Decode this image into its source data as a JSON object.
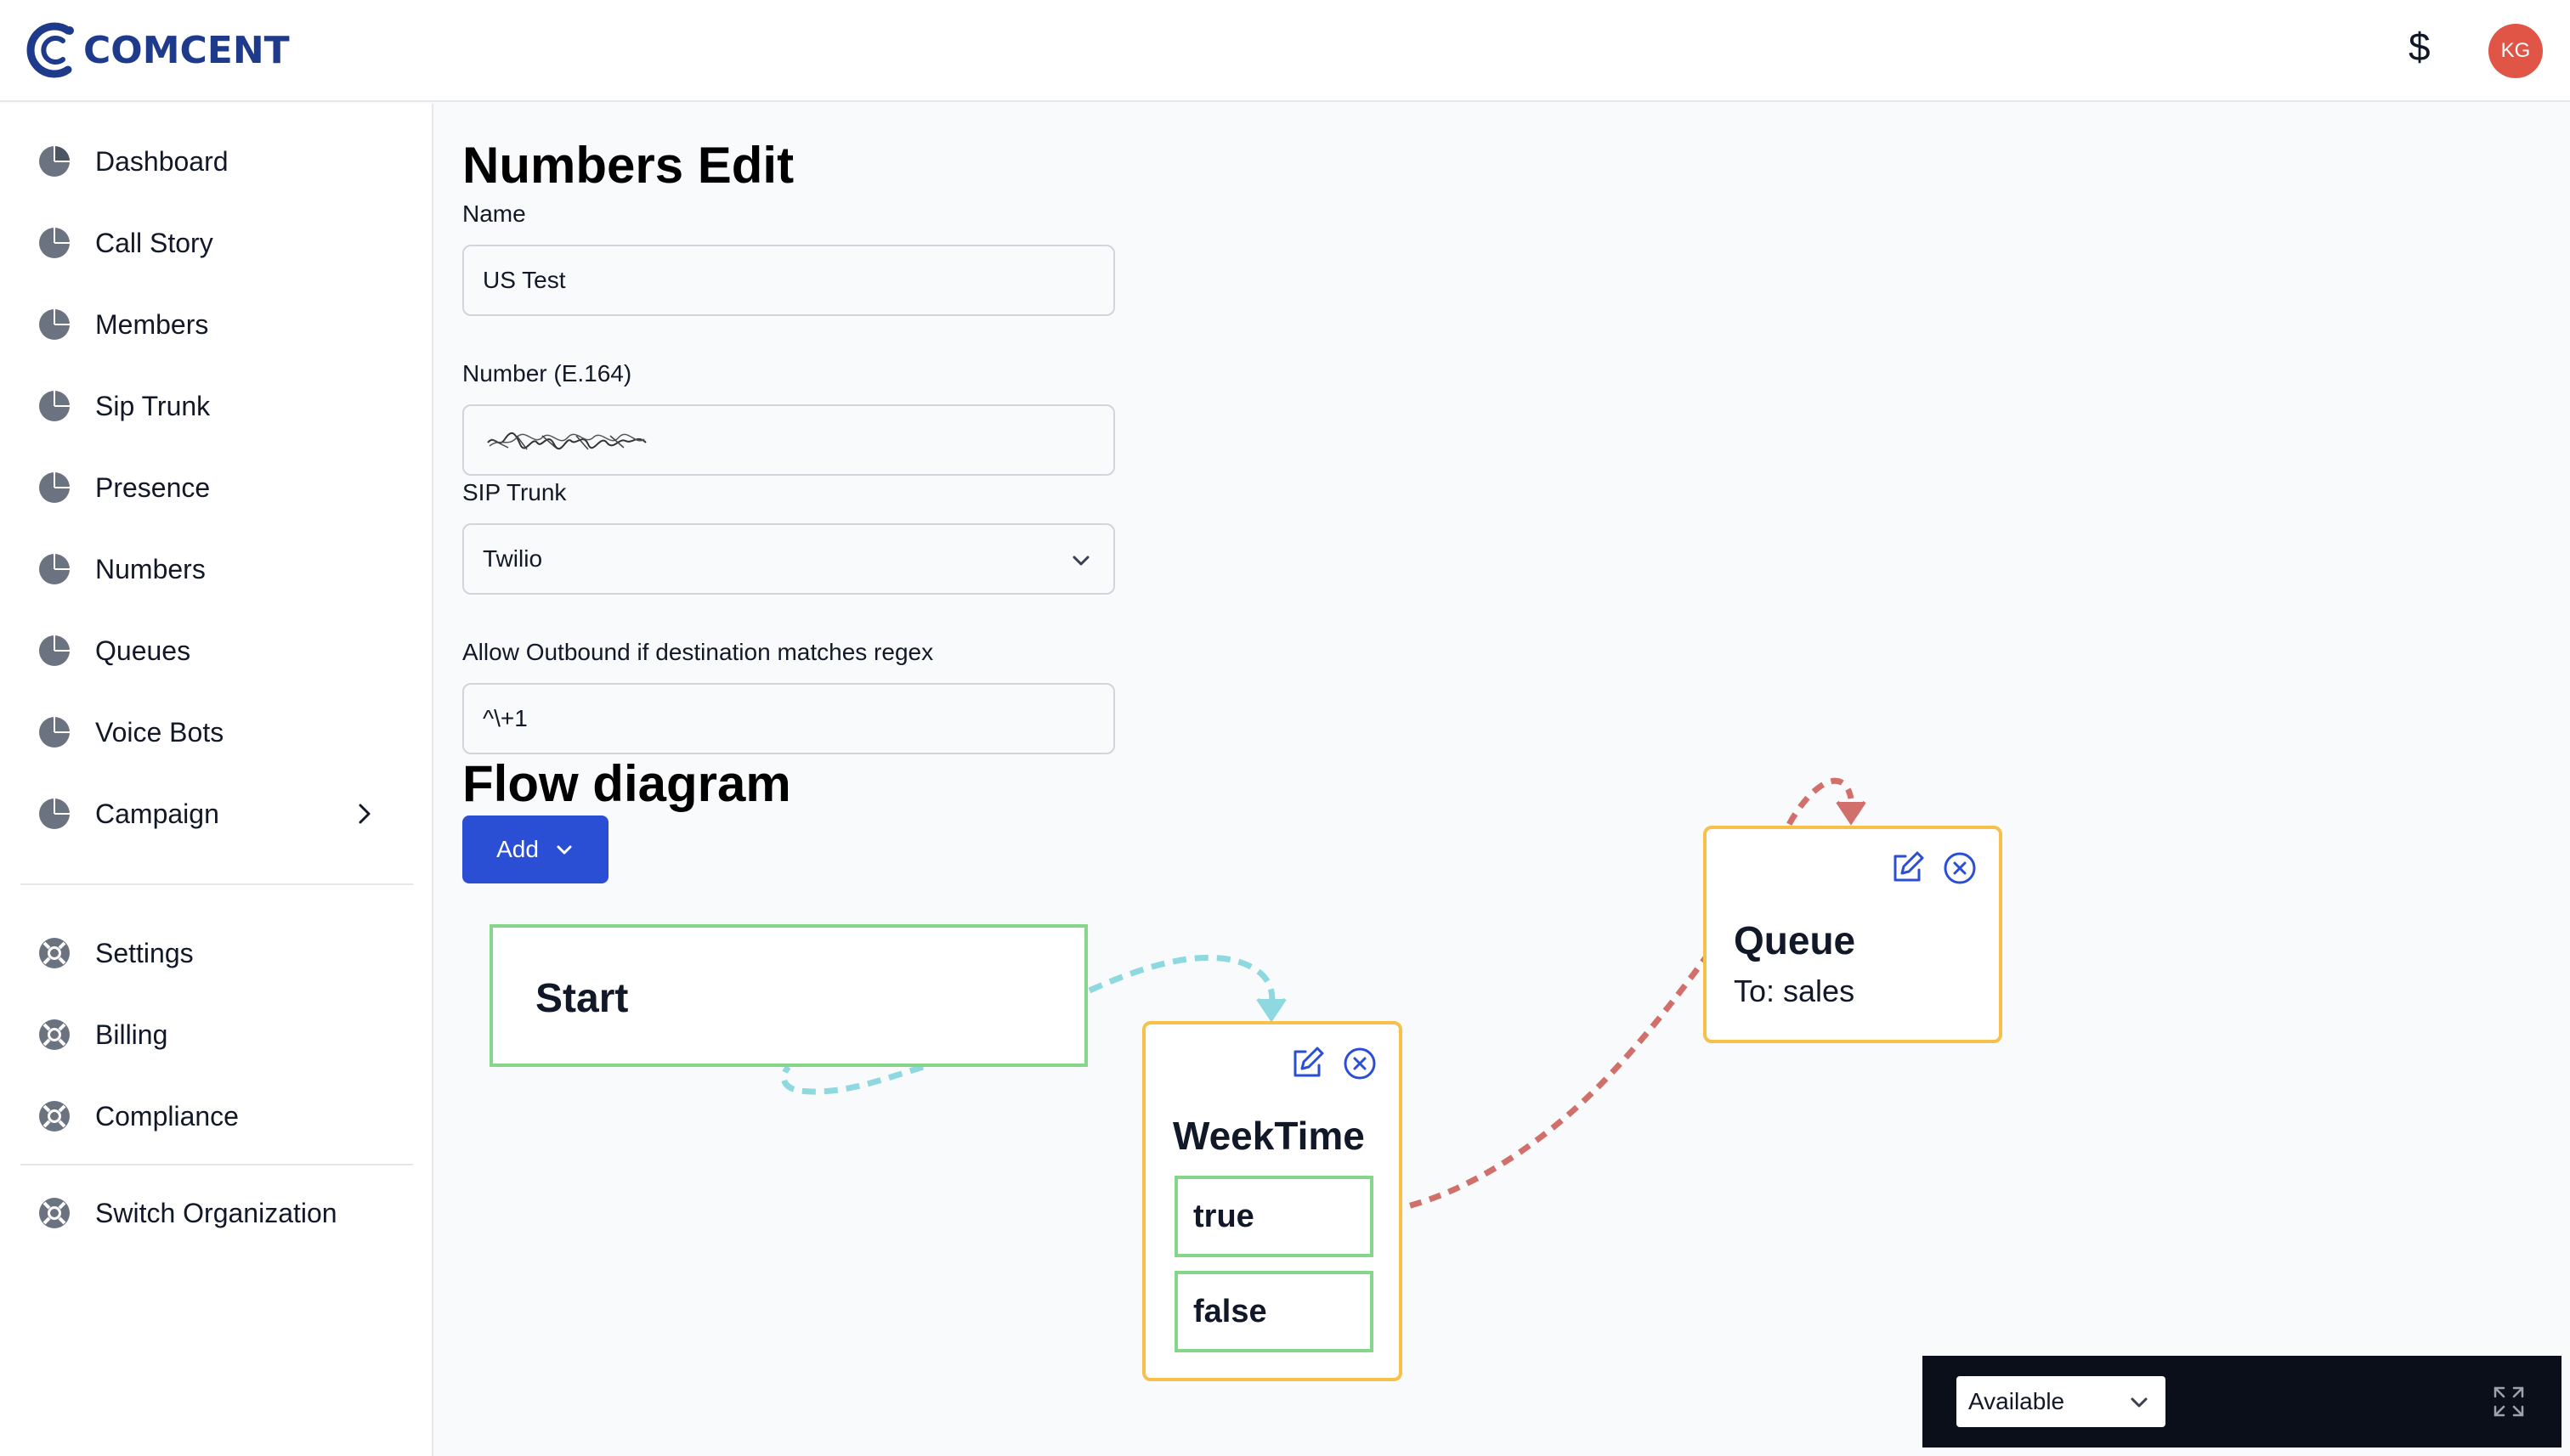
{
  "brand": {
    "name": "COMCENT"
  },
  "header": {
    "currency_symbol": "$",
    "avatar_initials": "KG"
  },
  "sidebar": {
    "items": [
      {
        "label": "Dashboard",
        "icon": "pie-chart-icon"
      },
      {
        "label": "Call Story",
        "icon": "pie-chart-icon"
      },
      {
        "label": "Members",
        "icon": "pie-chart-icon"
      },
      {
        "label": "Sip Trunk",
        "icon": "pie-chart-icon"
      },
      {
        "label": "Presence",
        "icon": "pie-chart-icon"
      },
      {
        "label": "Numbers",
        "icon": "pie-chart-icon"
      },
      {
        "label": "Queues",
        "icon": "pie-chart-icon"
      },
      {
        "label": "Voice Bots",
        "icon": "pie-chart-icon"
      },
      {
        "label": "Campaign",
        "icon": "pie-chart-icon"
      }
    ],
    "secondary_items": [
      {
        "label": "Settings",
        "icon": "lifebuoy-icon"
      },
      {
        "label": "Billing",
        "icon": "lifebuoy-icon"
      },
      {
        "label": "Compliance",
        "icon": "lifebuoy-icon"
      }
    ],
    "switch_org": {
      "label": "Switch Organization",
      "icon": "lifebuoy-icon"
    }
  },
  "form": {
    "title": "Numbers Edit",
    "name_label": "Name",
    "name_value": "US Test",
    "number_label": "Number (E.164)",
    "sip_label": "SIP Trunk",
    "sip_value": "Twilio",
    "regex_label": "Allow Outbound if destination matches regex",
    "regex_value": "^\\+1"
  },
  "flow": {
    "title": "Flow diagram",
    "add_label": "Add",
    "nodes": {
      "start": {
        "title": "Start"
      },
      "weektime": {
        "title": "WeekTime",
        "branches": [
          "true",
          "false"
        ]
      },
      "queue": {
        "title": "Queue",
        "subtitle": "To: sales"
      }
    },
    "colors": {
      "start_edge": "#8ed8e0",
      "true_edge": "#d1706b",
      "node_border": "#f6c04a",
      "branch_border": "#86d68a",
      "accent": "#2b4fd4"
    }
  },
  "status": {
    "value": "Available"
  }
}
